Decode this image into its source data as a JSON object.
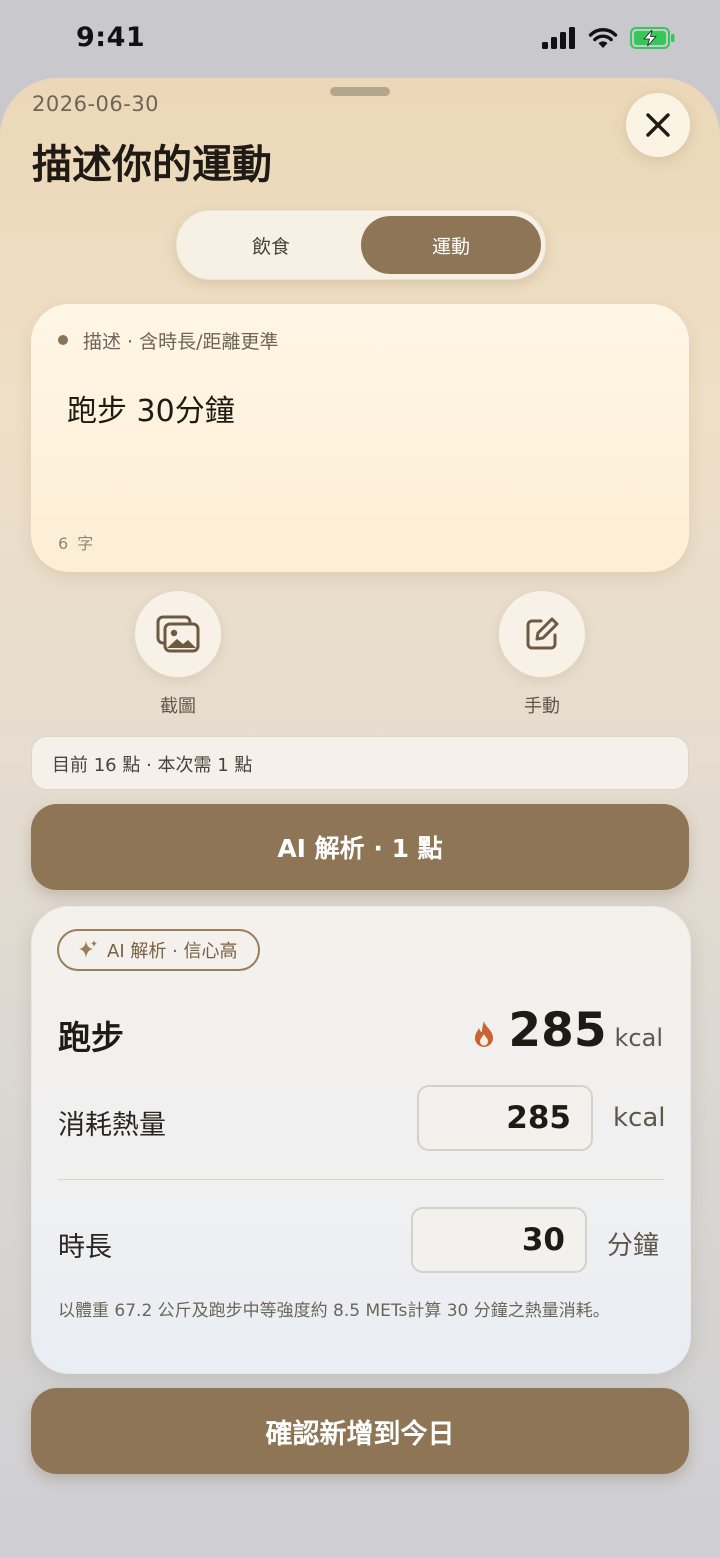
{
  "status_bar": {
    "time": "9:41"
  },
  "sheet": {
    "date": "2026-06-30",
    "title": "描述你的運動"
  },
  "segmented": {
    "options": [
      {
        "label": "飲食",
        "selected": false
      },
      {
        "label": "運動",
        "selected": true
      }
    ]
  },
  "description": {
    "hint": "描述 · 含時長/距離更準",
    "text": "跑步 30分鐘",
    "char_count": "6 字"
  },
  "tools": {
    "screenshot_label": "截圖",
    "manual_label": "手動"
  },
  "points": {
    "text": "目前 16 點 · 本次需 1 點"
  },
  "ai_button": {
    "label": "AI 解析 · 1 點"
  },
  "result": {
    "badge": "AI 解析 · 信心高",
    "activity": "跑步",
    "kcal": "285",
    "kcal_unit": "kcal",
    "calories_label": "消耗熱量",
    "calories_value": "285",
    "calories_unit": "kcal",
    "duration_label": "時長",
    "duration_value": "30",
    "duration_unit": "分鐘",
    "note": "以體重 67.2 公斤及跑步中等強度約 8.5 METs計算 30 分鐘之熱量消耗。"
  },
  "confirm_button": {
    "label": "確認新增到今日"
  },
  "colors": {
    "accent": "#8e7556",
    "flame": "#c8642f",
    "battery": "#34c759"
  }
}
